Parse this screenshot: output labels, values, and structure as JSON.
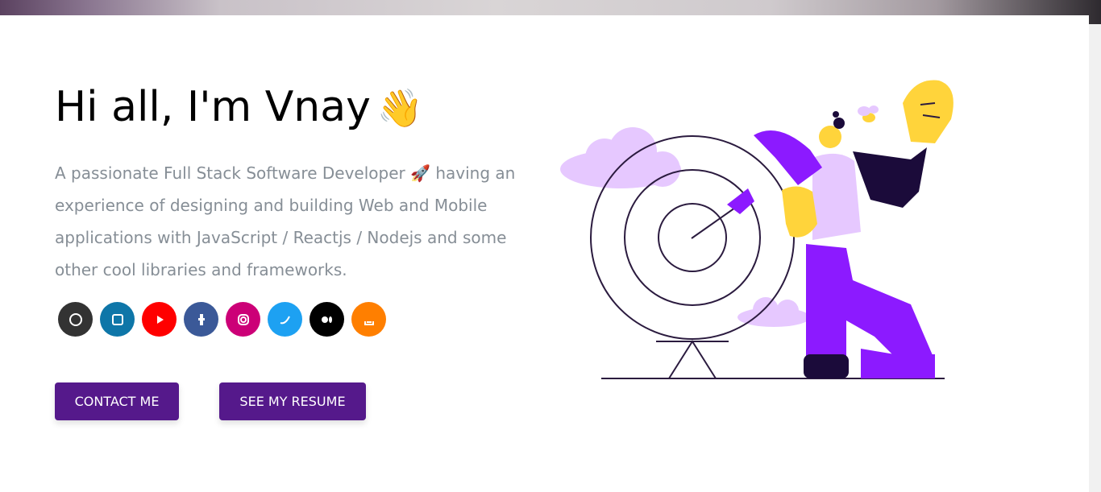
{
  "hero": {
    "greeting": "Hi all, I'm Vnay",
    "greeting_emoji": "👋",
    "subtitle": "A passionate Full Stack Software Developer 🚀 having an experience of designing and building Web and Mobile applications with JavaScript / Reactjs / Nodejs and some other cool libraries and frameworks."
  },
  "social": [
    {
      "name": "github",
      "color": "#333333"
    },
    {
      "name": "linkedin",
      "color": "#0e76a8"
    },
    {
      "name": "youtube",
      "color": "#ff0000"
    },
    {
      "name": "facebook",
      "color": "#3b5998"
    },
    {
      "name": "instagram",
      "color": "#cc0077"
    },
    {
      "name": "twitter",
      "color": "#1da1f2"
    },
    {
      "name": "medium",
      "color": "#000000"
    },
    {
      "name": "stackoverflow",
      "color": "#ff7f00"
    }
  ],
  "buttons": {
    "contact_label": "CONTACT ME",
    "resume_label": "SEE MY RESUME"
  },
  "colors": {
    "accent": "#55198b",
    "subtitle_text": "#868e96",
    "illustration_purple": "#8c1aff",
    "illustration_lavender": "#e6c8ff",
    "illustration_yellow": "#ffd43b"
  }
}
